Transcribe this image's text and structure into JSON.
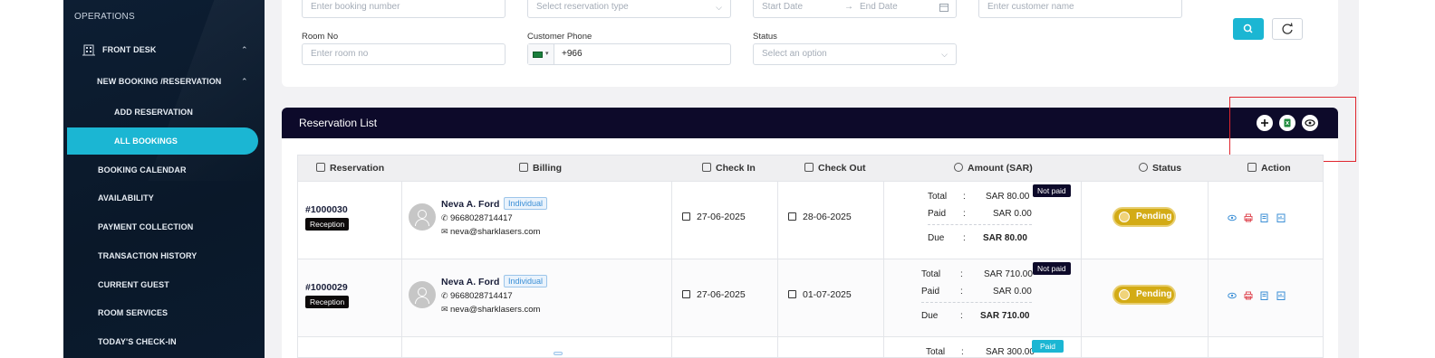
{
  "sidebar": {
    "section": "OPERATIONS",
    "front_desk": "FRONT DESK",
    "new_booking": "NEW BOOKING /RESERVATION",
    "add_reservation": "ADD RESERVATION",
    "all_bookings": "ALL BOOKINGS",
    "items": [
      "BOOKING CALENDAR",
      "AVAILABILITY",
      "PAYMENT COLLECTION",
      "TRANSACTION HISTORY",
      "CURRENT GUEST",
      "ROOM SERVICES",
      "TODAY'S CHECK-IN"
    ]
  },
  "filters": {
    "booking_number_placeholder": "Enter booking number",
    "reservation_type_placeholder": "Select reservation type",
    "start_date_placeholder": "Start Date",
    "end_date_placeholder": "End Date",
    "customer_name_placeholder": "Enter customer name",
    "room_no_label": "Room No",
    "room_no_placeholder": "Enter room no",
    "customer_phone_label": "Customer Phone",
    "customer_phone_value": "+966",
    "status_label": "Status",
    "status_placeholder": "Select an option"
  },
  "list": {
    "title": "Reservation List",
    "columns": [
      "Reservation",
      "Billing",
      "Check In",
      "Check Out",
      "Amount (SAR)",
      "Status",
      "Action"
    ],
    "rows": [
      {
        "id": "#1000030",
        "source": "Reception",
        "name": "Neva A. Ford",
        "type": "Individual",
        "phone": "9668028714417",
        "email": "neva@sharklasers.com",
        "check_in": "27-06-2025",
        "check_out": "28-06-2025",
        "total_label": "Total",
        "total": "SAR 80.00",
        "paid_label": "Paid",
        "paid": "SAR 0.00",
        "due_label": "Due",
        "due": "SAR 80.00",
        "payment_badge": "Not paid",
        "status": "Pending"
      },
      {
        "id": "#1000029",
        "source": "Reception",
        "name": "Neva A. Ford",
        "type": "Individual",
        "phone": "9668028714417",
        "email": "neva@sharklasers.com",
        "check_in": "27-06-2025",
        "check_out": "01-07-2025",
        "total_label": "Total",
        "total": "SAR 710.00",
        "paid_label": "Paid",
        "paid": "SAR 0.00",
        "due_label": "Due",
        "due": "SAR 710.00",
        "payment_badge": "Not paid",
        "status": "Pending"
      },
      {
        "total_label": "Total",
        "total": "SAR 300.00",
        "payment_badge": "Paid"
      }
    ],
    "colon": ":"
  },
  "colors": {
    "sidebar_bg": "#0d1e33",
    "accent": "#1bb6d3",
    "header_bg": "#0d0a2a",
    "pending": "#d3ab15",
    "highlight": "#e0252d"
  },
  "icons": [
    "building-icon",
    "chevron-up-icon",
    "search-icon",
    "refresh-icon",
    "plus-icon",
    "excel-icon",
    "eye-icon",
    "calendar-icon",
    "phone-icon",
    "mail-icon",
    "user-icon",
    "clock-icon",
    "print-icon",
    "edit-icon",
    "invoice-icon"
  ]
}
